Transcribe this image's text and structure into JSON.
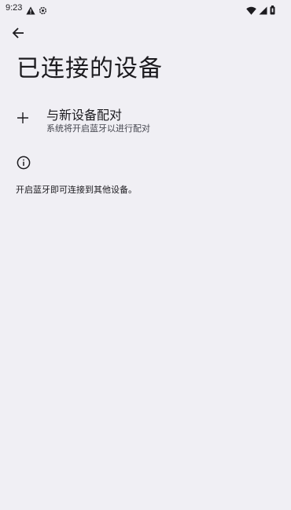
{
  "status_bar": {
    "time": "9:23",
    "left_icons": [
      "warning-icon",
      "settings-icon"
    ],
    "right_icons": [
      "wifi-icon",
      "signal-icon",
      "battery-icon"
    ]
  },
  "header": {
    "back_icon": "arrow-back-icon",
    "title": "已连接的设备"
  },
  "pair_new_device": {
    "icon": "plus-icon",
    "title": "与新设备配对",
    "summary": "系统将开启蓝牙以进行配对"
  },
  "footer": {
    "icon": "info-icon",
    "text": "开启蓝牙即可连接到其他设备。"
  },
  "colors": {
    "background": "#f0eff4",
    "text_primary": "#1c1b1f",
    "text_secondary": "#45464f"
  }
}
